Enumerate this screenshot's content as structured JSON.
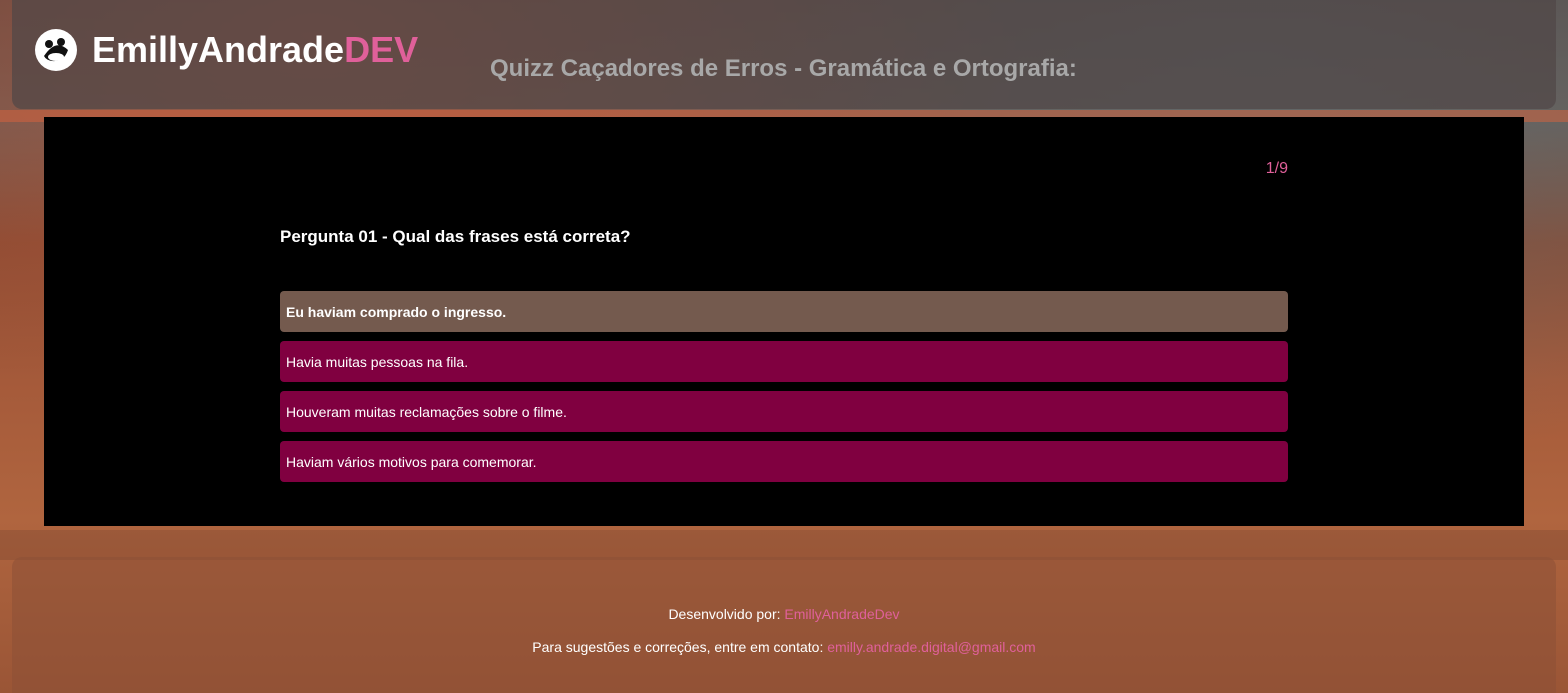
{
  "header": {
    "brand_main": "EmillyAndrade",
    "brand_accent": "DEV",
    "logo_icon": "panda-icon",
    "title": "Quizz Caçadores de Erros - Gramática e Ortografia:"
  },
  "quiz": {
    "counter": "1/9",
    "question": "Pergunta 01 - Qual das frases está correta?",
    "answers": [
      "Eu haviam comprado o ingresso.",
      "Havia muitas pessoas na fila.",
      "Houveram muitas reclamações sobre o filme.",
      "Haviam vários motivos para comemorar."
    ],
    "selected_index": 0
  },
  "footer": {
    "dev_label": "Desenvolvido por:",
    "dev_link": "EmillyAndradeDev",
    "contact_label": "Para sugestões e correções, entre em contato:",
    "contact_email": "emilly.andrade.digital@gmail.com"
  },
  "colors": {
    "accent": "#e0609a",
    "answer_bg": "#800040",
    "answer_selected_bg": "#745a4e",
    "quiz_bg": "#000000"
  }
}
